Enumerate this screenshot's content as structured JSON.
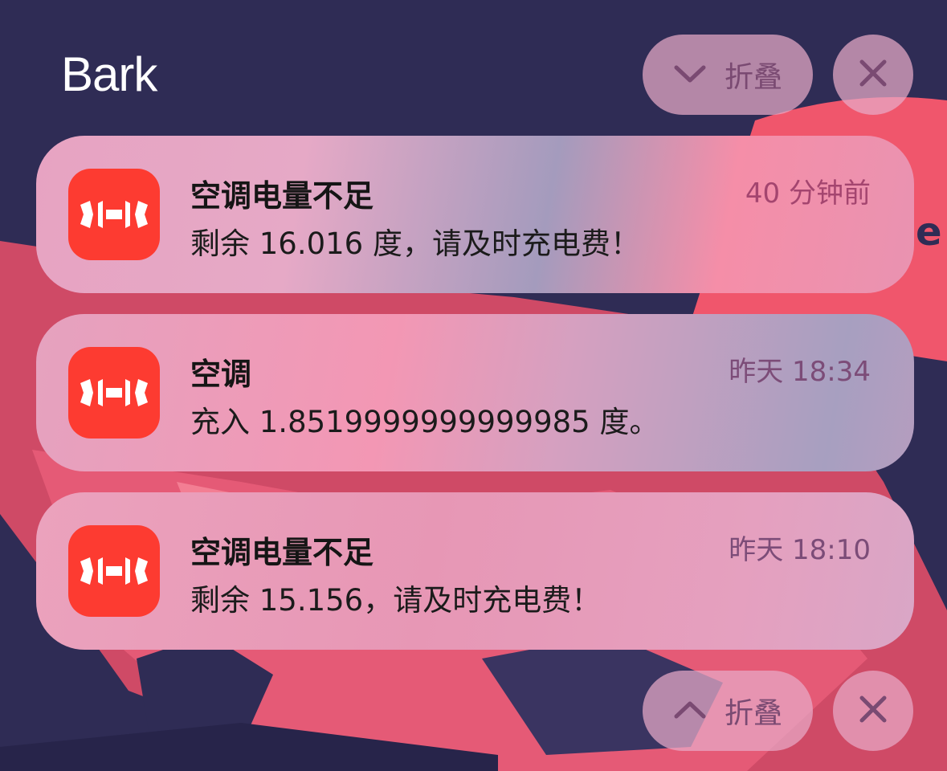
{
  "header": {
    "app_name": "Bark",
    "collapse_label": "折叠",
    "icons": {
      "collapse": "chevron-down-icon",
      "clear": "close-icon"
    }
  },
  "footer": {
    "collapse_label": "折叠",
    "icons": {
      "collapse": "chevron-up-icon",
      "clear": "close-icon"
    }
  },
  "notifications": [
    {
      "app_icon": "bark-bell-icon",
      "title": "空调电量不足",
      "body": "剩余 16.016 度，请及时充电费！",
      "time": "40 分钟前"
    },
    {
      "app_icon": "bark-bell-icon",
      "title": "空调",
      "body": "充入 1.8519999999999985 度。",
      "time": "昨天 18:34"
    },
    {
      "app_icon": "bark-bell-icon",
      "title": "空调电量不足",
      "body": "剩余 15.156，请及时充电费！",
      "time": "昨天 18:10"
    }
  ],
  "colors": {
    "background": "#2f2c55",
    "app_icon": "#fd3b31",
    "accent_pink": "#f0566c",
    "button_glyph": "#7a4a72"
  }
}
